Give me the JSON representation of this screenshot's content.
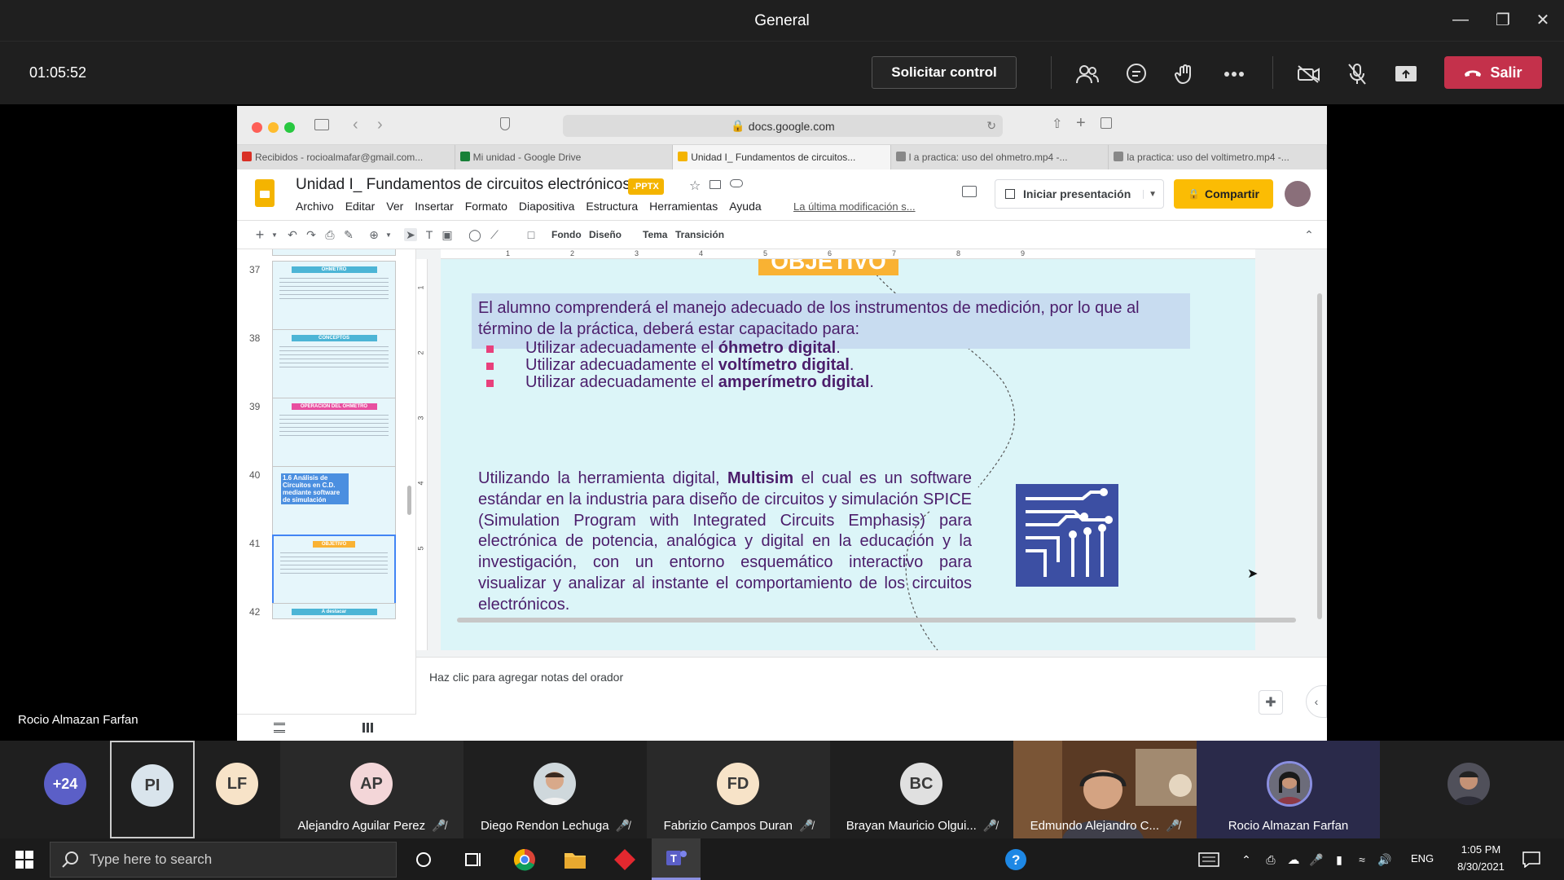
{
  "window": {
    "title": "General"
  },
  "meeting": {
    "timer": "01:05:52",
    "request_control_label": "Solicitar control",
    "leave_label": "Salir",
    "presenter_name": "Rocio Almazan Farfan"
  },
  "browser": {
    "url": "docs.google.com",
    "tabs": [
      {
        "label": "Recibidos - rocioalmafar@gmail.com...",
        "fav_color": "#d93025"
      },
      {
        "label": "Mi unidad - Google Drive",
        "fav_color": "#188038"
      },
      {
        "label": "Unidad I_ Fundamentos de circuitos...",
        "fav_color": "#f4b400"
      },
      {
        "label": "l a practica: uso del ohmetro.mp4 -...",
        "fav_color": "#888888"
      },
      {
        "label": "la practica: uso del voltimetro.mp4 -...",
        "fav_color": "#888888"
      }
    ]
  },
  "slides_app": {
    "doc_title": "Unidad I_ Fundamentos de circuitos electrónicos",
    "file_badge": ".PPTX",
    "menu": [
      "Archivo",
      "Editar",
      "Ver",
      "Insertar",
      "Formato",
      "Diapositiva",
      "Estructura",
      "Herramientas",
      "Ayuda"
    ],
    "last_edit": "La última modificación s...",
    "present_label": "Iniciar presentación",
    "share_label": "Compartir",
    "toolbar": {
      "background": "Fondo",
      "layout": "Diseño",
      "theme": "Tema",
      "transition": "Transición"
    },
    "ruler_marks": [
      "1",
      "2",
      "3",
      "4",
      "5",
      "6",
      "7",
      "8",
      "9"
    ],
    "vruler_marks": [
      "1",
      "2",
      "3",
      "4",
      "5"
    ],
    "filmstrip": [
      {
        "num": "37",
        "caption": "OHMETRO"
      },
      {
        "num": "38",
        "caption": "CONCEPTOS"
      },
      {
        "num": "39",
        "caption": "OPERACIÓN DEL ÓHMETRO"
      },
      {
        "num": "40",
        "caption": "1.6 Análisis de Circuitos en C.D. mediante software de simulación"
      },
      {
        "num": "41",
        "caption": "OBJETIVO"
      },
      {
        "num": "42",
        "caption": "A destacar"
      }
    ],
    "notes_placeholder": "Haz clic para agregar notas del orador"
  },
  "slide": {
    "banner": "OBJETIVO",
    "intro": "El alumno comprenderá el manejo adecuado de los instrumentos de medición, por lo que al término de la práctica, deberá estar capacitado para:",
    "bullets": [
      {
        "prefix": "Utilizar adecuadamente el ",
        "bold": "óhmetro digital",
        "suffix": "."
      },
      {
        "prefix": "Utilizar adecuadamente el ",
        "bold": "voltímetro digital",
        "suffix": "."
      },
      {
        "prefix": "Utilizar adecuadamente el ",
        "bold": "amperímetro digital",
        "suffix": "."
      }
    ],
    "para_prefix": "Utilizando la herramienta digital, ",
    "para_bold": "Multisim",
    "para_rest": " el cual es un software estándar en la industria para diseño de circuitos y simulación SPICE (Simulation Program with Integrated Circuits Emphasis) para electrónica de potencia, analógica y digital en la educación y la investigación, con un entorno esquemático interactivo para visualizar y analizar al instante el comportamiento de los circuitos electrónicos."
  },
  "participants": {
    "overflow_count": "+24",
    "tiles": [
      {
        "initials": "PI",
        "name": "",
        "color": "#d9e4ec"
      },
      {
        "initials": "LF",
        "name": "",
        "color": "#f7e3c8"
      },
      {
        "initials": "AP",
        "name": "Alejandro Aguilar Perez",
        "color": "#f3d6d8"
      },
      {
        "initials": "",
        "name": "Diego Rendon Lechuga",
        "color": "#cfd8dc"
      },
      {
        "initials": "FD",
        "name": "Fabrizio Campos Duran",
        "color": "#f7e3c8"
      },
      {
        "initials": "BC",
        "name": "Brayan Mauricio Olgui...",
        "color": "#e0e0e0"
      },
      {
        "initials": "",
        "name": "Edmundo Alejandro C...",
        "color": "#6b4a2e"
      },
      {
        "initials": "",
        "name": "Rocio Almazan Farfan",
        "color": "#3b3a5c"
      }
    ]
  },
  "taskbar": {
    "search_placeholder": "Type here to search",
    "lang": "ENG",
    "time": "1:05 PM",
    "date": "8/30/2021"
  },
  "colors": {
    "leave_red": "#c4314b",
    "slide_bg": "#dcf5f8",
    "slide_text": "#4b1d6b",
    "banner": "#f9b233",
    "share": "#fbbc04"
  }
}
